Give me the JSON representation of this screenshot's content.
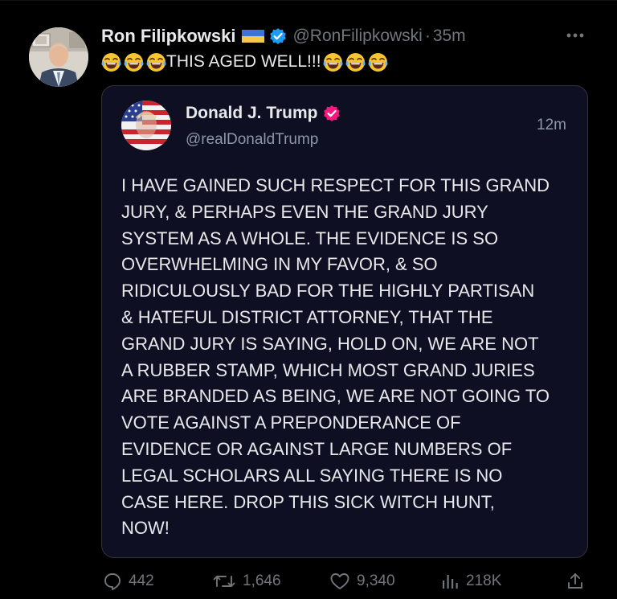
{
  "colors": {
    "background": "#000000",
    "text_primary": "#e7e9ea",
    "text_secondary": "#71767b",
    "quote_background": "#0f0f23",
    "quote_border": "#2f3336",
    "verified_blue": "#1d9bf0",
    "verified_red": "#f91880"
  },
  "tweet": {
    "author": {
      "display_name": "Ron Filipkowski",
      "handle": "@RonFilipkowski",
      "separator": "·",
      "time": "35m",
      "flag_icon": "ukraine-flag-icon",
      "verified_icon": "verified-badge-blue-icon"
    },
    "text": "THIS AGED WELL!!!",
    "emoji_icon": "face-with-tears-of-joy-icon",
    "emoji_before_count": 3,
    "emoji_after_count": 3,
    "more_icon": "more-horizontal-icon"
  },
  "quote": {
    "display_name": "Donald J. Trump",
    "handle": "@realDonaldTrump",
    "time": "12m",
    "verified_icon": "verified-badge-red-icon",
    "body": "I HAVE GAINED SUCH RESPECT FOR THIS GRAND\nJURY, & PERHAPS EVEN THE GRAND JURY\nSYSTEM AS A WHOLE. THE EVIDENCE IS SO\nOVERWHELMING IN MY FAVOR, & SO\nRIDICULOUSLY BAD FOR THE HIGHLY PARTISAN\n& HATEFUL DISTRICT ATTORNEY, THAT THE\nGRAND JURY IS SAYING, HOLD ON, WE ARE NOT\nA RUBBER STAMP, WHICH MOST GRAND JURIES\nARE BRANDED AS BEING, WE ARE NOT GOING TO\nVOTE AGAINST A PREPONDERANCE OF\nEVIDENCE OR AGAINST LARGE NUMBERS OF\nLEGAL SCHOLARS ALL SAYING THERE IS NO\nCASE HERE. DROP THIS SICK WITCH HUNT,\nNOW!"
  },
  "actions": {
    "replies": {
      "icon": "reply-icon",
      "count": "442"
    },
    "reposts": {
      "icon": "repost-icon",
      "count": "1,646"
    },
    "likes": {
      "icon": "heart-icon",
      "count": "9,340"
    },
    "views": {
      "icon": "views-chart-icon",
      "count": "218K"
    },
    "share": {
      "icon": "share-icon"
    }
  }
}
